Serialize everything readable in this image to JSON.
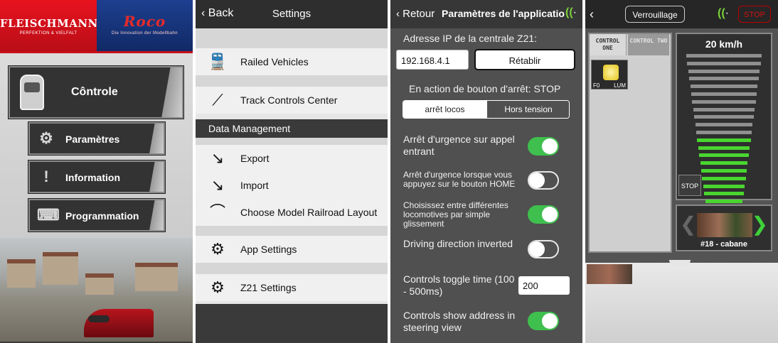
{
  "panel1": {
    "brand_left": "FLEISCHMANN",
    "brand_left_tag": "PERFEKTION & VIELFALT",
    "brand_right": "Roco",
    "brand_right_tag": "Die Innovation der Modellbahn",
    "buttons": [
      "Cônt​role",
      "Paramètres",
      "Information",
      "Programmation"
    ]
  },
  "panel2": {
    "back": "Back",
    "title": "Settings",
    "items": [
      "Railed Vehicles",
      "Track Controls Center"
    ],
    "section": "Data Management",
    "data_items": [
      "Export",
      "Import",
      "Choose Model Railroad Layout"
    ],
    "app_settings": "App Settings",
    "z21_settings": "Z21 Settings"
  },
  "panel3": {
    "back": "Retour",
    "title": "Paramètres de l'applicatio",
    "ip_label": "Adresse IP de la centrale Z21:",
    "ip_value": "192.168.4.1",
    "reset": "Rétablir",
    "stop_action": "En action de bouton d'arrêt: STOP",
    "seg_left": "arrêt locos",
    "seg_right": "Hors tension",
    "opt1": "Arrêt d'urgence sur appel entrant",
    "opt2": "Arrêt d'urgence lorsque vous appuyez sur le bouton HOME",
    "opt3": "Choisissez entre différentes locomotives par simple glissement",
    "opt4": "Driving direction inverted",
    "opt5": "Controls toggle time (100 - 500ms)",
    "opt5_value": "200",
    "opt6": "Controls show address in steering view",
    "toggles": [
      true,
      false,
      true,
      false,
      true
    ]
  },
  "panel4": {
    "lock": "Verrouillage",
    "stop": "STOP",
    "tab_one": "CONTROL ONE",
    "tab_two": "CONTROL TWO",
    "f0": "F0",
    "lum": "LUM",
    "speed": "20 km/h",
    "speed_value": 20,
    "stop_small": "STOP",
    "loco_name": "#18 - cabane"
  },
  "colors": {
    "accent_green": "#49d62f",
    "brand_red": "#e8131f",
    "brand_blue": "#1d3f8f",
    "stop_red": "#d01111"
  }
}
